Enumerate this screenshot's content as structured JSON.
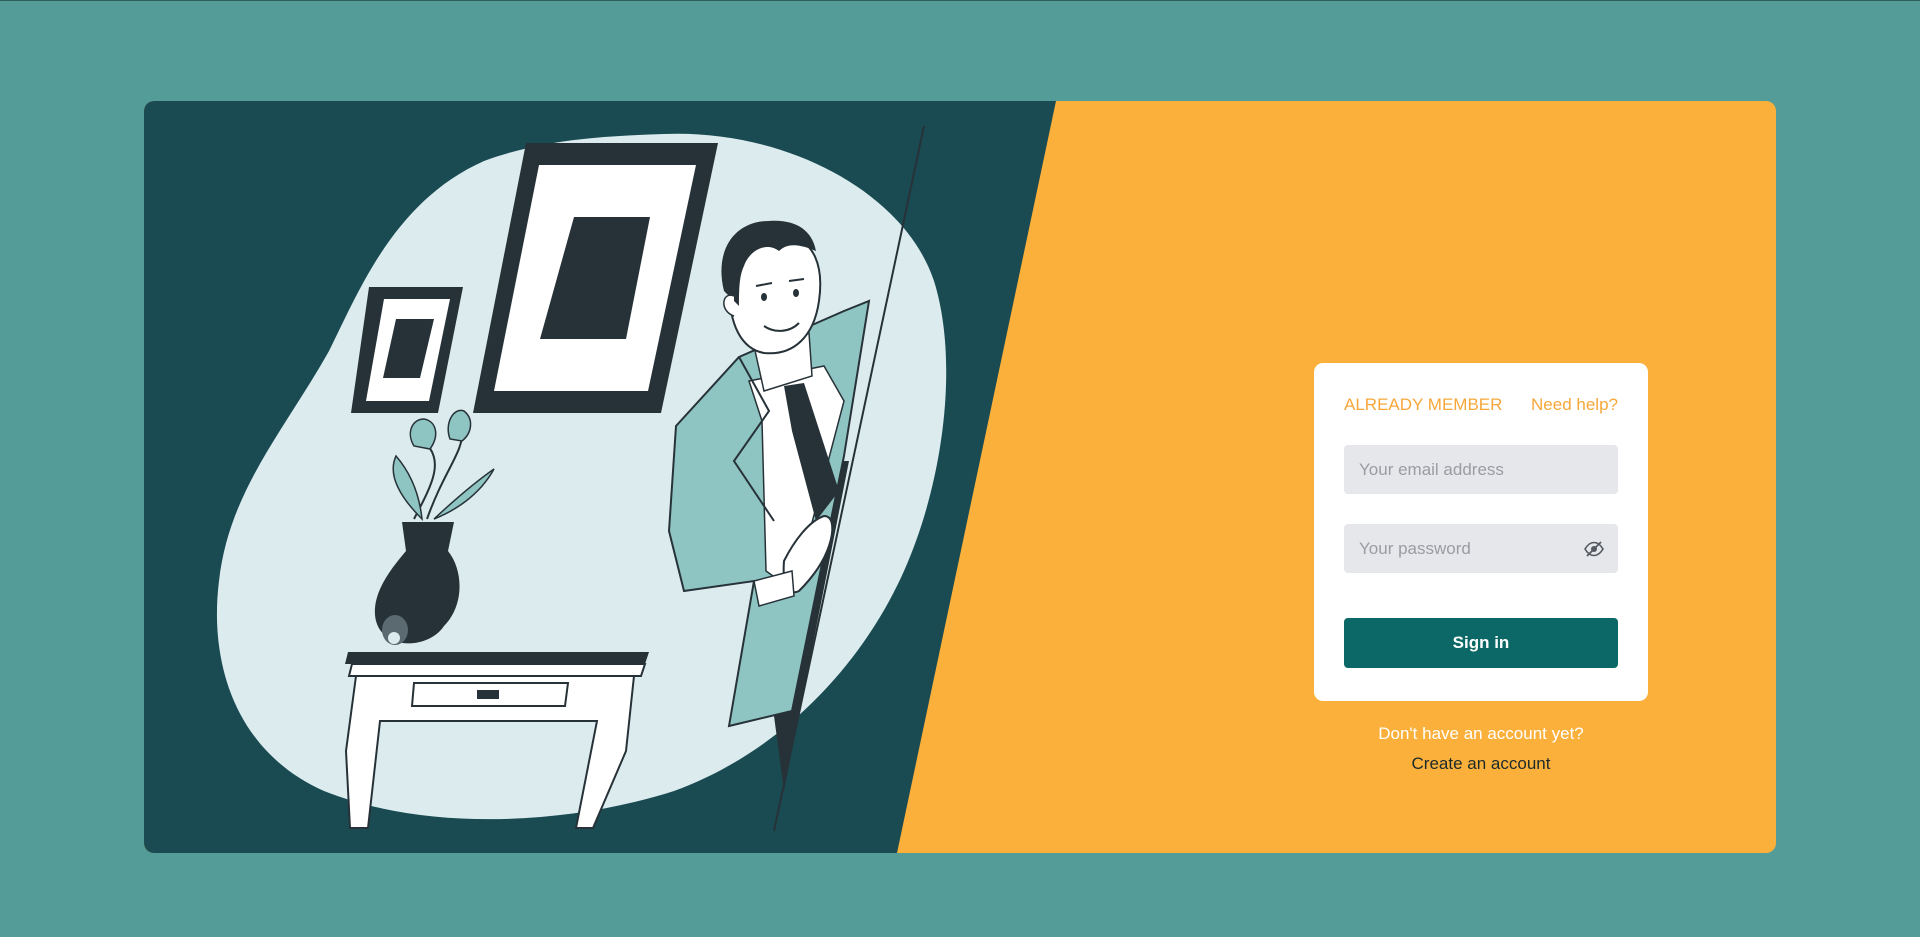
{
  "colors": {
    "page_background": "#549c97",
    "left_panel": "#1a4b53",
    "right_panel": "#fbb03b",
    "accent_text": "#f7a73a",
    "primary_button": "#0c6866",
    "input_background": "#e6e7eb"
  },
  "login": {
    "heading": "ALREADY MEMBER",
    "help_link": "Need help?",
    "email_placeholder": "Your email address",
    "password_placeholder": "Your password",
    "show_password_icon": "eye-slash-icon",
    "sign_in_label": "Sign in"
  },
  "signup": {
    "prompt": "Don't have an account yet?",
    "link": "Create an account"
  }
}
